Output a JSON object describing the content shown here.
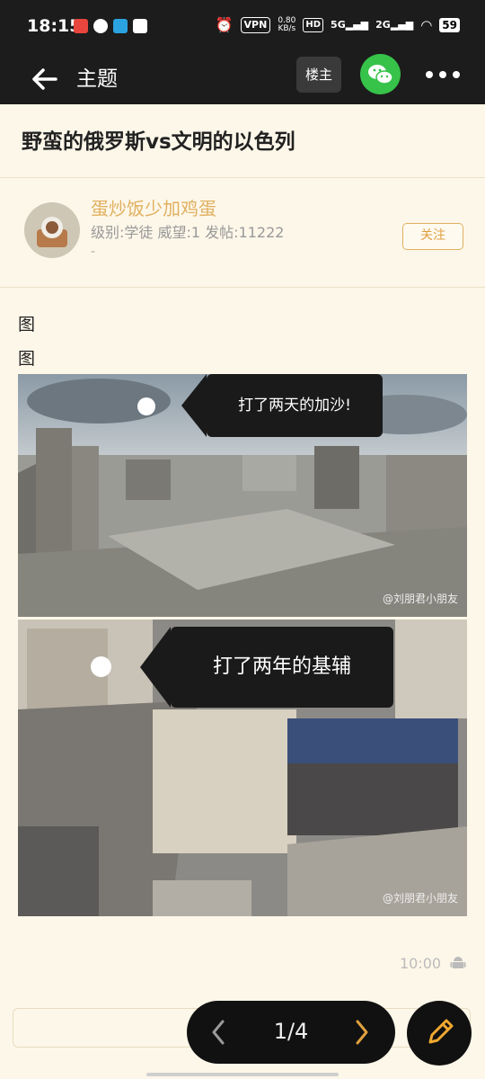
{
  "status_bar": {
    "time": "18:15",
    "vpn": "VPN",
    "speed_value": "0.80",
    "speed_unit": "KB/s",
    "hd": "HD",
    "net1": "5G",
    "net2": "2G",
    "battery": "59"
  },
  "header": {
    "title": "主题",
    "louzhu_label": "楼主"
  },
  "post": {
    "title": "野蛮的俄罗斯vs文明的以色列",
    "author": {
      "name": "蛋炒饭少加鸡蛋",
      "meta": "级别:学徒 威望:1 发帖:11222",
      "dash": "-",
      "follow_label": "关注"
    },
    "body_lines": [
      "图",
      "图"
    ],
    "images": [
      {
        "caption": "打了两天的加沙!",
        "watermark": "@刘朋君小朋友"
      },
      {
        "caption": "打了两年的基辅",
        "watermark": "@刘朋君小朋友"
      }
    ],
    "time": "10:00"
  },
  "pager": {
    "text": "1/4"
  },
  "icons": {
    "back": "back-arrow-icon",
    "wechat": "wechat-icon",
    "more": "more-dots-icon",
    "android": "android-icon",
    "prev": "chevron-left-icon",
    "next": "chevron-right-icon",
    "edit": "pencil-icon"
  },
  "colors": {
    "bar": "#1c1c1c",
    "page_bg": "#fdf7e9",
    "accent": "#e0b060",
    "wechat": "#37c24a"
  }
}
